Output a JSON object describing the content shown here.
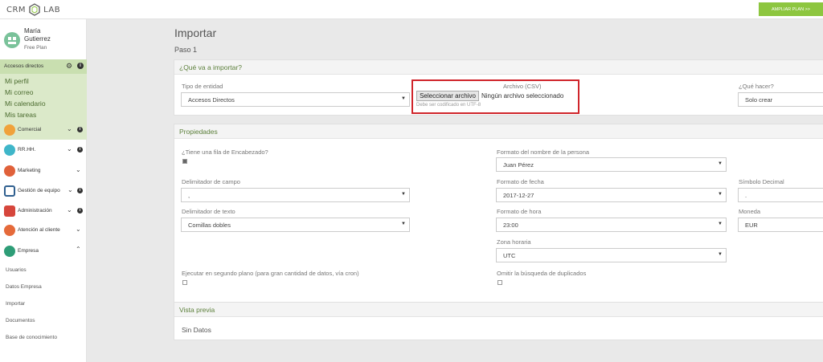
{
  "brand": {
    "left": "CRM",
    "right": "LAB"
  },
  "header": {
    "plan_button": "AMPLIAR PLAN >>"
  },
  "user": {
    "first_name": "María",
    "last_name": "Gutierrez",
    "plan": "Free Plan"
  },
  "quick_access": {
    "title": "Accesos directos",
    "links": [
      "Mi perfil",
      "Mi correo",
      "Mi calendario",
      "Mis tareas"
    ]
  },
  "nav": [
    {
      "label": "Comercial",
      "color": "#f0a23b"
    },
    {
      "label": "RR.HH.",
      "color": "#3fb6c9"
    },
    {
      "label": "Marketing",
      "color": "#e0613a"
    },
    {
      "label": "Gestión de equipo",
      "color": "#2f5f8f"
    },
    {
      "label": "Administración",
      "color": "#d6463c"
    },
    {
      "label": "Atención al cliente",
      "color": "#e56a3a"
    },
    {
      "label": "Empresa",
      "color": "#2e9d77"
    }
  ],
  "empresa_links": [
    "Usuarios",
    "Datos Empresa",
    "Importar",
    "Documentos",
    "Base de conocimiento"
  ],
  "page": {
    "title": "Importar",
    "step": "Paso 1"
  },
  "import_panel": {
    "title": "¿Qué va a importar?",
    "entity_label": "Tipo de entidad",
    "entity_value": "Accesos Directos",
    "file_label": "Archivo (CSV)",
    "file_button": "Seleccionar archivo",
    "file_status": "Ningún archivo seleccionado",
    "file_hint": "Debe ser codificado en UTF-8",
    "action_label": "¿Qué hacer?",
    "action_value": "Solo crear"
  },
  "props_panel": {
    "title": "Propiedades",
    "header_row_label": "¿Tiene una fila de Encabezado?",
    "header_row_checked": true,
    "name_format_label": "Formato del nombre de la persona",
    "name_format_value": "Juan Pérez",
    "field_delim_label": "Delimitador de campo",
    "field_delim_value": ",",
    "date_format_label": "Formato de fecha",
    "date_format_value": "2017-12-27",
    "decimal_label": "Símbolo Decimal",
    "decimal_value": ".",
    "text_delim_label": "Delimitador de texto",
    "text_delim_value": "Comillas dobles",
    "time_format_label": "Formato de hora",
    "time_format_value": "23:00",
    "currency_label": "Moneda",
    "currency_value": "EUR",
    "timezone_label": "Zona horaria",
    "timezone_value": "UTC",
    "background_label": "Ejecutar en segundo plano (para gran cantidad de datos, vía cron)",
    "background_checked": false,
    "dup_label": "Omitir la búsqueda de duplicados",
    "dup_checked": false
  },
  "preview_panel": {
    "title": "Vista previa",
    "empty": "Sin Datos"
  },
  "colors": {
    "accent_green": "#8dc63f",
    "highlight_red": "#d0252b",
    "quick_bg": "#dbe9c9"
  }
}
